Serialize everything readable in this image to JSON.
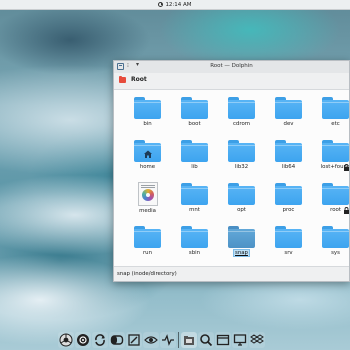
{
  "top_panel": {
    "clock": "12:14 AM"
  },
  "window": {
    "title": "Root — Dolphin",
    "location": "Root",
    "status": "snap (inode/directory)",
    "selected_item": "snap",
    "items": [
      {
        "name": "bin",
        "icon": "folder"
      },
      {
        "name": "boot",
        "icon": "folder"
      },
      {
        "name": "cdrom",
        "icon": "folder"
      },
      {
        "name": "dev",
        "icon": "folder"
      },
      {
        "name": "etc",
        "icon": "folder"
      },
      {
        "name": "home",
        "icon": "folder-home"
      },
      {
        "name": "lib",
        "icon": "folder"
      },
      {
        "name": "lib32",
        "icon": "folder"
      },
      {
        "name": "lib64",
        "icon": "folder"
      },
      {
        "name": "lost+found",
        "icon": "folder-locked"
      },
      {
        "name": "media",
        "icon": "optical-disc-file"
      },
      {
        "name": "mnt",
        "icon": "folder"
      },
      {
        "name": "opt",
        "icon": "folder"
      },
      {
        "name": "proc",
        "icon": "folder"
      },
      {
        "name": "root",
        "icon": "folder-locked"
      },
      {
        "name": "run",
        "icon": "folder"
      },
      {
        "name": "sbin",
        "icon": "folder"
      },
      {
        "name": "snap",
        "icon": "folder"
      },
      {
        "name": "srv",
        "icon": "folder"
      },
      {
        "name": "sys",
        "icon": "folder"
      }
    ]
  },
  "dock": {
    "items": [
      "chrome-icon",
      "focus-icon",
      "sync-icon",
      "theme-icon",
      "editor-icon",
      "eye-icon",
      "network-icon",
      "files-icon",
      "search-icon",
      "window-icon",
      "monitor-icon",
      "dropbox-icon"
    ]
  },
  "colors": {
    "folder": "#3da4ef",
    "selection": "#bde0f7",
    "location_icon": "#e74c3c"
  }
}
